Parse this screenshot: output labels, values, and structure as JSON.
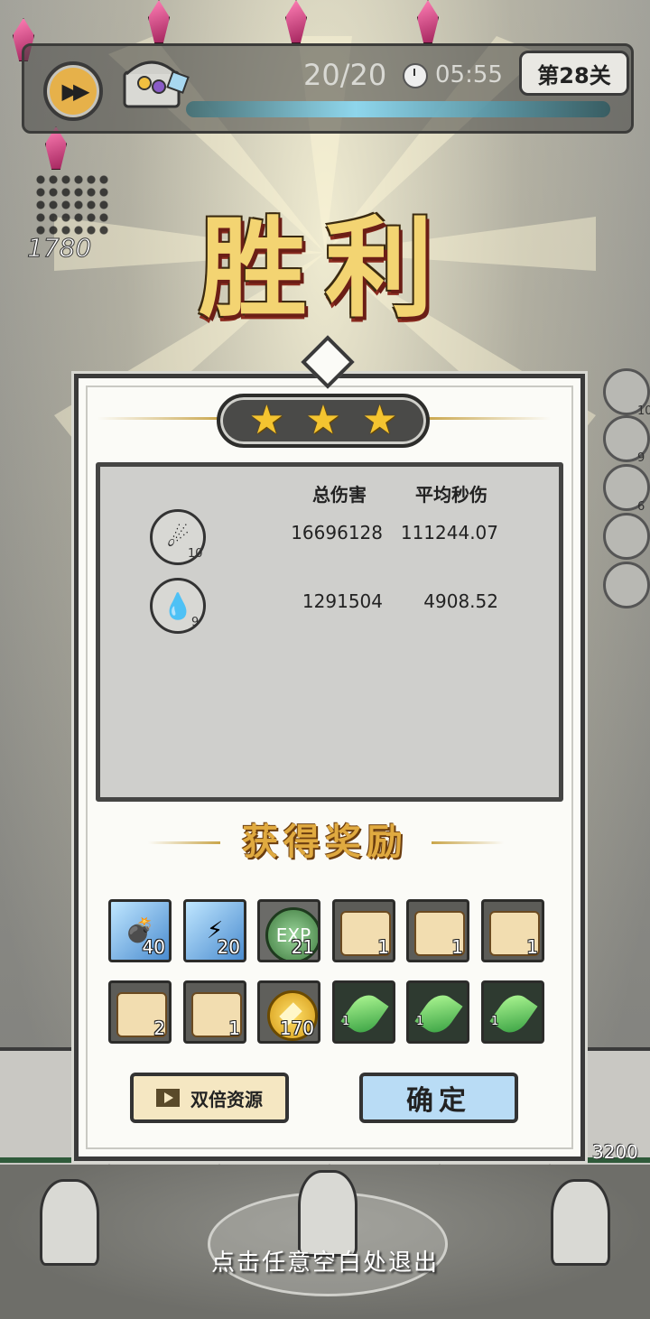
{
  "hud": {
    "wave": "20/20",
    "time": "05:55",
    "level": "第28关",
    "progress": 1.0
  },
  "floating": {
    "damage_number": "1780",
    "hp_number": "3200"
  },
  "side_skills": [
    {
      "level": "10"
    },
    {
      "level": "9"
    },
    {
      "level": "6"
    },
    {
      "level": ""
    },
    {
      "level": ""
    }
  ],
  "victory_title": "胜利",
  "stars": 3,
  "stats": {
    "col_total": "总伤害",
    "col_dps": "平均秒伤",
    "rows": [
      {
        "icon": "stone-skill-icon",
        "level": "10",
        "total": "16696128",
        "dps": "111244.07"
      },
      {
        "icon": "splash-skill-icon",
        "level": "9",
        "total": "1291504",
        "dps": "4908.52"
      }
    ]
  },
  "rewards_title": "获得奖励",
  "rewards": [
    {
      "icon": "bomb-ice-icon",
      "count": "40"
    },
    {
      "icon": "lightning-ice-icon",
      "count": "20"
    },
    {
      "icon": "exp-icon",
      "count": "21"
    },
    {
      "icon": "scroll-ring-icon",
      "count": "1"
    },
    {
      "icon": "scroll-hat-icon",
      "count": "1"
    },
    {
      "icon": "scroll-staff-icon",
      "count": "1"
    },
    {
      "icon": "scroll-cloak-icon",
      "count": "2"
    },
    {
      "icon": "scroll-glove-icon",
      "count": "1"
    },
    {
      "icon": "gold-coin-icon",
      "count": "170"
    },
    {
      "icon": "green-leaf-icon",
      "count": "1"
    },
    {
      "icon": "green-leaf-icon",
      "count": "1"
    },
    {
      "icon": "green-leaf-icon",
      "count": "1"
    }
  ],
  "buttons": {
    "double": "双倍资源",
    "confirm": "确定"
  },
  "exit_tip": "点击任意空白处退出",
  "colors": {
    "gold": "#f3d472",
    "star": "#f4c430",
    "confirm_bg": "#b9dcf5",
    "double_bg": "#f5e7c2"
  }
}
